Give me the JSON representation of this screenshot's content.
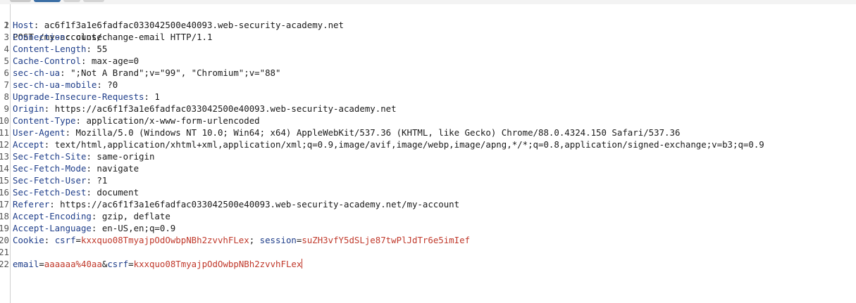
{
  "request_line": "POST /my-account/change-email HTTP/1.1",
  "headers": [
    {
      "n": "2",
      "key": "Host",
      "value": "ac6f1f3a1e6fadfac033042500e40093.web-security-academy.net"
    },
    {
      "n": "3",
      "key": "Connection",
      "value": "close"
    },
    {
      "n": "4",
      "key": "Content-Length",
      "value": "55"
    },
    {
      "n": "5",
      "key": "Cache-Control",
      "value": "max-age=0"
    },
    {
      "n": "6",
      "key": "sec-ch-ua",
      "value": "\";Not A Brand\";v=\"99\", \"Chromium\";v=\"88\""
    },
    {
      "n": "7",
      "key": "sec-ch-ua-mobile",
      "value": "?0"
    },
    {
      "n": "8",
      "key": "Upgrade-Insecure-Requests",
      "value": "1"
    },
    {
      "n": "9",
      "key": "Origin",
      "value": "https://ac6f1f3a1e6fadfac033042500e40093.web-security-academy.net"
    },
    {
      "n": "10",
      "key": "Content-Type",
      "value": "application/x-www-form-urlencoded"
    },
    {
      "n": "11",
      "key": "User-Agent",
      "value": "Mozilla/5.0 (Windows NT 10.0; Win64; x64) AppleWebKit/537.36 (KHTML, like Gecko) Chrome/88.0.4324.150 Safari/537.36"
    },
    {
      "n": "12",
      "key": "Accept",
      "value": "text/html,application/xhtml+xml,application/xml;q=0.9,image/avif,image/webp,image/apng,*/*;q=0.8,application/signed-exchange;v=b3;q=0.9"
    },
    {
      "n": "13",
      "key": "Sec-Fetch-Site",
      "value": "same-origin"
    },
    {
      "n": "14",
      "key": "Sec-Fetch-Mode",
      "value": "navigate"
    },
    {
      "n": "15",
      "key": "Sec-Fetch-User",
      "value": "?1"
    },
    {
      "n": "16",
      "key": "Sec-Fetch-Dest",
      "value": "document"
    },
    {
      "n": "17",
      "key": "Referer",
      "value": "https://ac6f1f3a1e6fadfac033042500e40093.web-security-academy.net/my-account"
    },
    {
      "n": "18",
      "key": "Accept-Encoding",
      "value": "gzip, deflate"
    },
    {
      "n": "19",
      "key": "Accept-Language",
      "value": "en-US,en;q=0.9"
    }
  ],
  "cookie": {
    "n": "20",
    "key": "Cookie",
    "csrf_name": "csrf",
    "csrf_value": "kxxquo08TmyajpOdOwbpNBh2zvvhFLex",
    "session_name": "session",
    "session_value": "suZH3vfY5dSLje87twPlJdTr6e5imIef"
  },
  "blank_line_number": "21",
  "body": {
    "n": "22",
    "email_name": "email",
    "email_value": "aaaaaa%40aa",
    "csrf_name": "csrf",
    "csrf_value": "kxxquo08TmyajpOdOwbpNBh2zvvhFLex"
  },
  "colors": {
    "header_key": "#1f3e8a",
    "param_value": "#c0392b",
    "line_number": "#555555"
  }
}
